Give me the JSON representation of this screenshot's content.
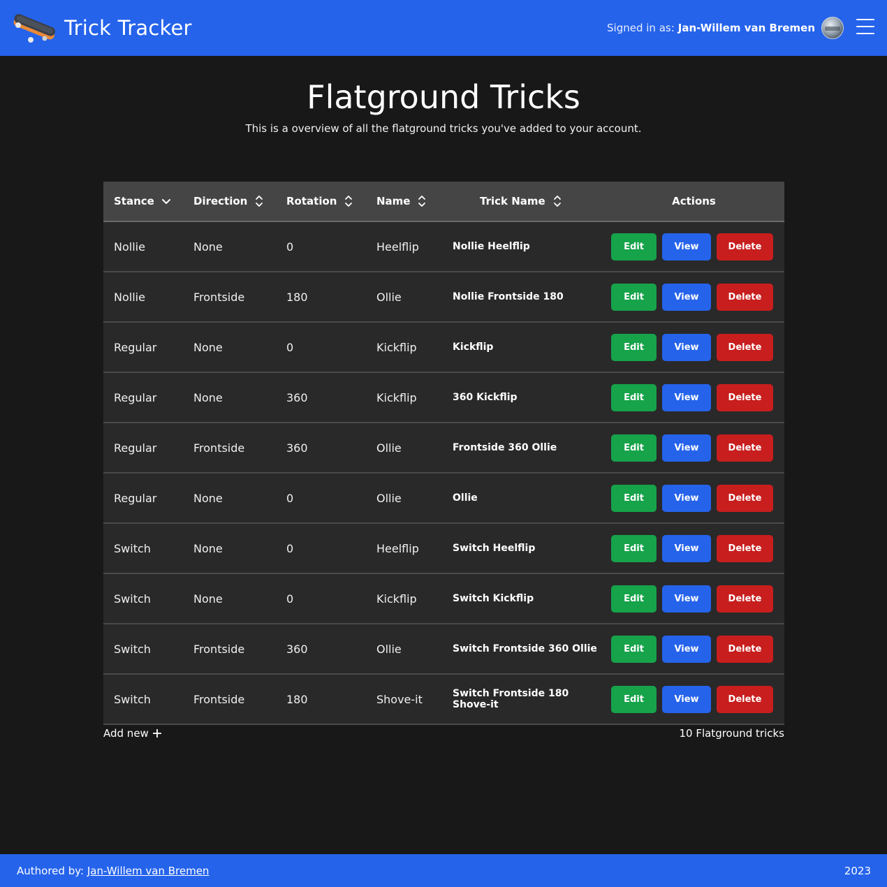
{
  "header": {
    "app_title": "Trick Tracker",
    "signed_in_label": "Signed in as:",
    "user_name": "Jan-Willem van Bremen"
  },
  "page": {
    "title": "Flatground Tricks",
    "subtitle": "This is a overview of all the flatground tricks you've added to your account."
  },
  "table": {
    "columns": {
      "stance": "Stance",
      "direction": "Direction",
      "rotation": "Rotation",
      "name": "Name",
      "trick_name": "Trick Name",
      "actions": "Actions"
    },
    "sort": {
      "active_column": "stance",
      "active_icon": "chevron-down-icon",
      "inactive_icon": "sort-updown-icon"
    },
    "buttons": {
      "edit": "Edit",
      "view": "View",
      "delete": "Delete"
    },
    "button_colors": {
      "edit": "#16a34a",
      "view": "#2563eb",
      "delete": "#c81e1e"
    },
    "rows": [
      {
        "stance": "Nollie",
        "direction": "None",
        "rotation": "0",
        "name": "Heelflip",
        "trick_name": "Nollie Heelflip"
      },
      {
        "stance": "Nollie",
        "direction": "Frontside",
        "rotation": "180",
        "name": "Ollie",
        "trick_name": "Nollie Frontside 180"
      },
      {
        "stance": "Regular",
        "direction": "None",
        "rotation": "0",
        "name": "Kickflip",
        "trick_name": "Kickflip"
      },
      {
        "stance": "Regular",
        "direction": "None",
        "rotation": "360",
        "name": "Kickflip",
        "trick_name": "360 Kickflip"
      },
      {
        "stance": "Regular",
        "direction": "Frontside",
        "rotation": "360",
        "name": "Ollie",
        "trick_name": "Frontside 360 Ollie"
      },
      {
        "stance": "Regular",
        "direction": "None",
        "rotation": "0",
        "name": "Ollie",
        "trick_name": "Ollie"
      },
      {
        "stance": "Switch",
        "direction": "None",
        "rotation": "0",
        "name": "Heelflip",
        "trick_name": "Switch Heelflip"
      },
      {
        "stance": "Switch",
        "direction": "None",
        "rotation": "0",
        "name": "Kickflip",
        "trick_name": "Switch Kickflip"
      },
      {
        "stance": "Switch",
        "direction": "Frontside",
        "rotation": "360",
        "name": "Ollie",
        "trick_name": "Switch Frontside 360 Ollie"
      },
      {
        "stance": "Switch",
        "direction": "Frontside",
        "rotation": "180",
        "name": "Shove-it",
        "trick_name": "Switch Frontside 180 Shove-it"
      }
    ],
    "add_new_label": "Add new",
    "count_label": "10 Flatground tricks"
  },
  "footer": {
    "authored_by_label": "Authored by:",
    "author_link": "Jan-Willem van Bremen",
    "year": "2023"
  },
  "colors": {
    "brand_blue": "#2563eb",
    "page_background": "#181818",
    "table_header": "#454545",
    "table_row": "#292929"
  }
}
